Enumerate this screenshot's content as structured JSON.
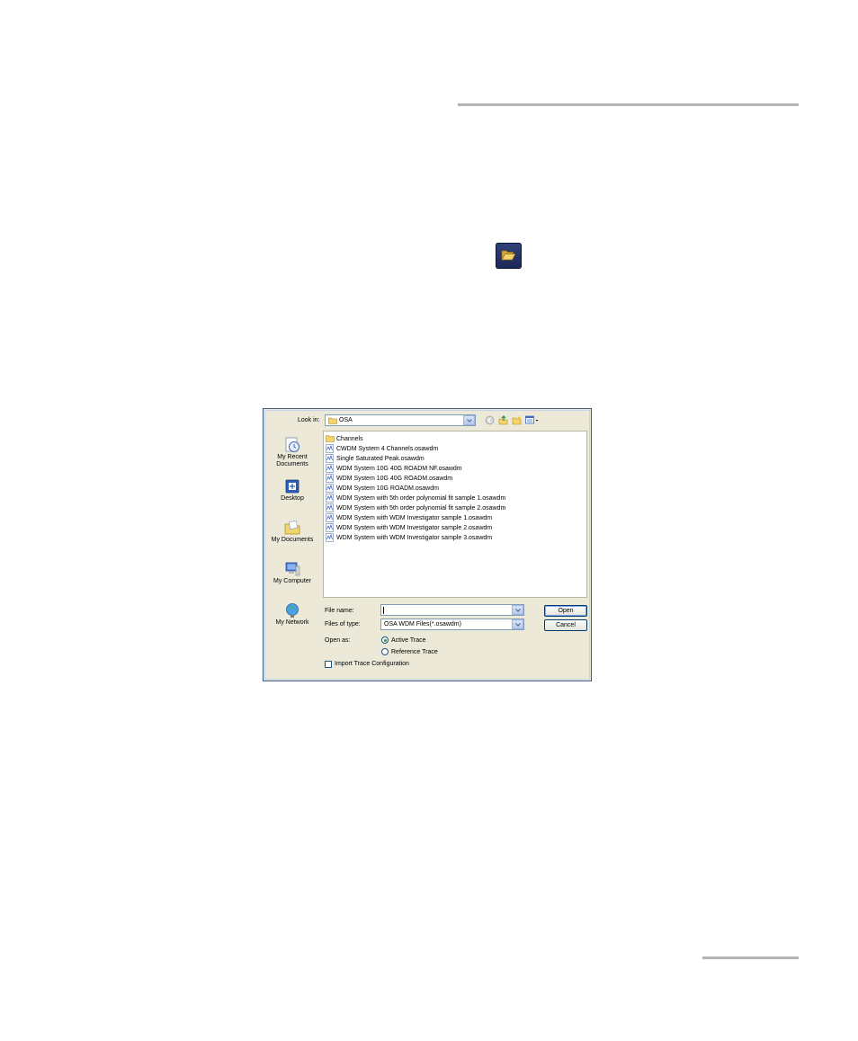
{
  "dialog": {
    "look_in_label": "Look in:",
    "look_in_value": "OSA",
    "places": [
      {
        "label": "My Recent Documents"
      },
      {
        "label": "Desktop"
      },
      {
        "label": "My Documents"
      },
      {
        "label": "My Computer"
      },
      {
        "label": "My Network"
      }
    ],
    "files": [
      {
        "name": "Channels",
        "kind": "folder"
      },
      {
        "name": "CWDM System 4 Channels.osawdm",
        "kind": "file"
      },
      {
        "name": "Single Saturated Peak.osawdm",
        "kind": "file"
      },
      {
        "name": "WDM System 10G 40G ROADM NF.osawdm",
        "kind": "file"
      },
      {
        "name": "WDM System 10G 40G ROADM.osawdm",
        "kind": "file"
      },
      {
        "name": "WDM System 10G ROADM.osawdm",
        "kind": "file"
      },
      {
        "name": "WDM System with 5th order polynomial fit sample 1.osawdm",
        "kind": "file"
      },
      {
        "name": "WDM System with 5th order polynomial fit sample 2.osawdm",
        "kind": "file"
      },
      {
        "name": "WDM System with WDM Investigator sample 1.osawdm",
        "kind": "file"
      },
      {
        "name": "WDM System with WDM Investigator sample 2.osawdm",
        "kind": "file"
      },
      {
        "name": "WDM System with WDM Investigator sample 3.osawdm",
        "kind": "file"
      }
    ],
    "file_name_label": "File name:",
    "file_name_value": "",
    "file_type_label": "Files of type:",
    "file_type_value": "OSA WDM Files(*.osawdm)",
    "open_button": "Open",
    "cancel_button": "Cancel",
    "open_as_label": "Open as:",
    "open_as_options": [
      "Active Trace",
      "Reference Trace"
    ],
    "open_as_selected": "Active Trace",
    "import_config_label": "Import Trace Configuration",
    "import_config_checked": false
  }
}
